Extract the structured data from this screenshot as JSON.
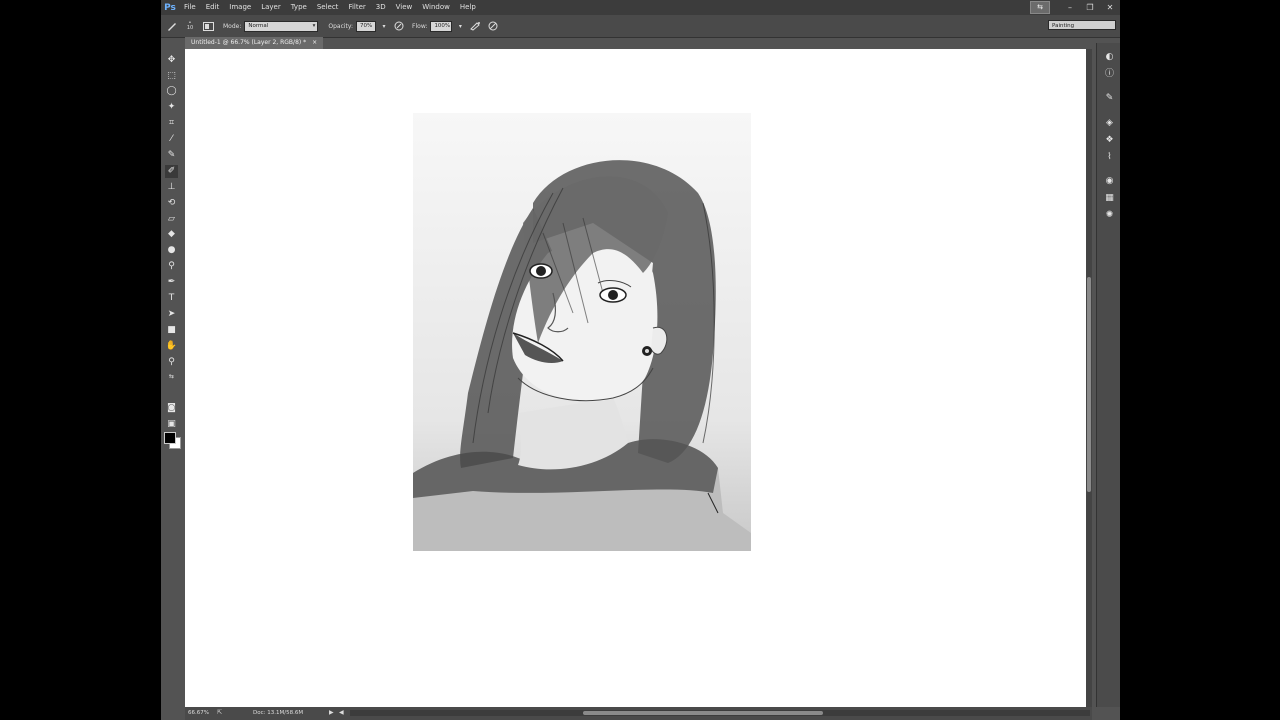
{
  "app": {
    "logo": "Ps"
  },
  "menu": [
    "File",
    "Edit",
    "Image",
    "Layer",
    "Type",
    "Select",
    "Filter",
    "3D",
    "View",
    "Window",
    "Help"
  ],
  "window_controls": {
    "arrange": "⇆",
    "minimize": "–",
    "restore": "❐",
    "close": "✕"
  },
  "options": {
    "brush_size": "10",
    "mode_label": "Mode:",
    "mode_value": "Normal",
    "opacity_label": "Opacity:",
    "opacity_value": "70%",
    "flow_label": "Flow:",
    "flow_value": "100%",
    "workspace": "Painting"
  },
  "document": {
    "tab_title": "Untitled-1 @ 66.7% (Layer 2, RGB/8) *",
    "tab_close": "×"
  },
  "status": {
    "zoom": "66.67%",
    "doc_info": "Doc: 13.1M/58.6M",
    "arrow_right": "▶",
    "arrow_left": "◀"
  },
  "colors": {
    "foreground": "#000000",
    "background": "#ffffff",
    "ui_panel": "#535353",
    "canvas": "#ffffff"
  },
  "tools": [
    "move-icon",
    "marquee-icon",
    "lasso-icon",
    "magic-wand-icon",
    "crop-icon",
    "eyedropper-icon",
    "healing-brush-icon",
    "brush-icon",
    "clone-stamp-icon",
    "history-brush-icon",
    "eraser-icon",
    "paint-bucket-icon",
    "blur-icon",
    "dodge-icon",
    "pen-icon",
    "type-icon",
    "path-selection-icon",
    "rectangle-icon",
    "hand-icon",
    "zoom-icon"
  ],
  "panels": [
    "color-panel-icon",
    "info-panel-icon",
    "brush-presets-icon",
    "layers-icon",
    "channels-icon",
    "paths-icon",
    "adjustments-icon",
    "swatches-icon",
    "styles-icon"
  ]
}
